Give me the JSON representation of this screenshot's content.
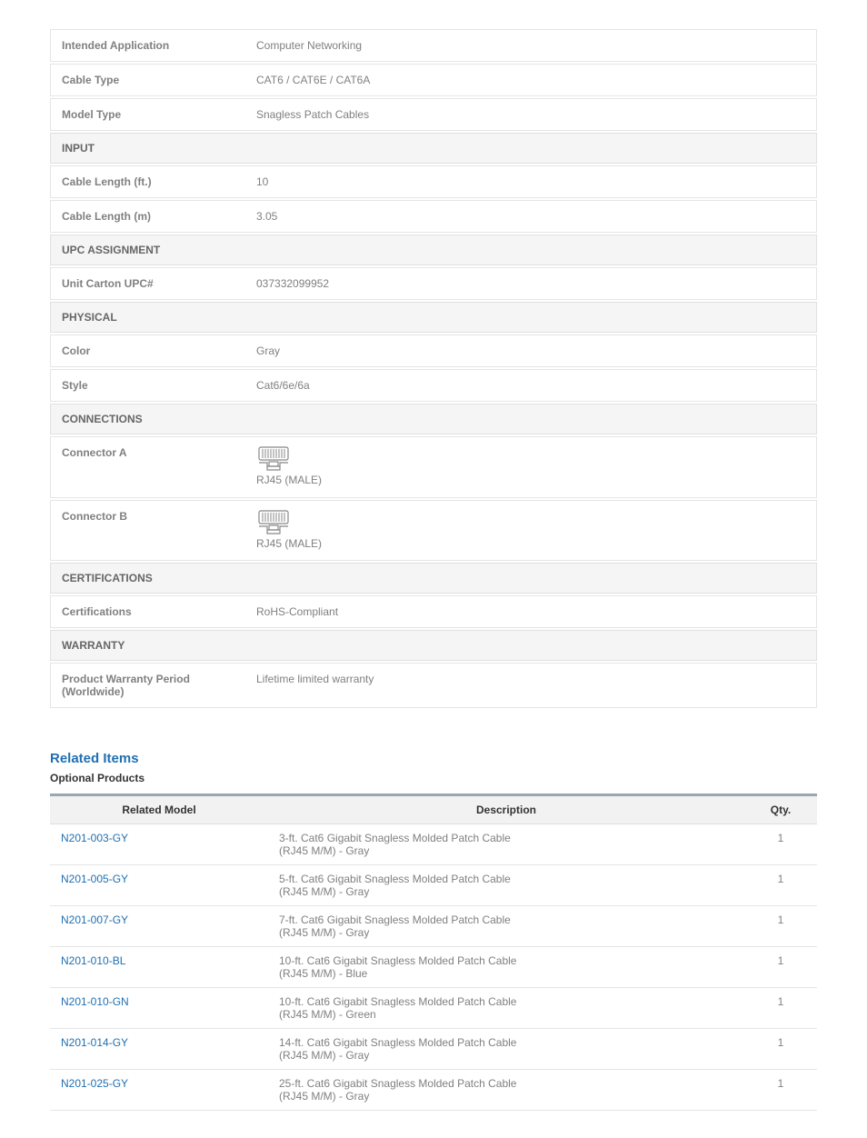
{
  "specs": {
    "rows": [
      {
        "type": "data",
        "label": "Intended Application",
        "value": "Computer Networking"
      },
      {
        "type": "data",
        "label": "Cable Type",
        "value": "CAT6 / CAT6E / CAT6A"
      },
      {
        "type": "data",
        "label": "Model Type",
        "value": "Snagless Patch Cables"
      },
      {
        "type": "section",
        "label": "INPUT"
      },
      {
        "type": "data",
        "label": "Cable Length (ft.)",
        "value": "10"
      },
      {
        "type": "data",
        "label": "Cable Length (m)",
        "value": "3.05"
      },
      {
        "type": "section",
        "label": "UPC ASSIGNMENT"
      },
      {
        "type": "data",
        "label": "Unit Carton UPC#",
        "value": "037332099952"
      },
      {
        "type": "section",
        "label": "PHYSICAL"
      },
      {
        "type": "data",
        "label": "Color",
        "value": "Gray"
      },
      {
        "type": "data",
        "label": "Style",
        "value": "Cat6/6e/6a"
      },
      {
        "type": "section",
        "label": "CONNECTIONS"
      },
      {
        "type": "connector",
        "label": "Connector A",
        "value": "RJ45 (MALE)"
      },
      {
        "type": "connector",
        "label": "Connector B",
        "value": "RJ45 (MALE)"
      },
      {
        "type": "section",
        "label": "CERTIFICATIONS"
      },
      {
        "type": "data",
        "label": "Certifications",
        "value": "RoHS-Compliant"
      },
      {
        "type": "section",
        "label": "WARRANTY"
      },
      {
        "type": "data",
        "label": "Product Warranty Period (Worldwide)",
        "value": "Lifetime limited warranty"
      }
    ]
  },
  "related": {
    "heading": "Related Items",
    "subheading": "Optional Products",
    "columns": {
      "model": "Related Model",
      "description": "Description",
      "qty": "Qty."
    },
    "items": [
      {
        "model": "N201-003-GY",
        "desc1": "3-ft. Cat6 Gigabit Snagless Molded Patch Cable",
        "desc2": "(RJ45 M/M) - Gray",
        "qty": "1"
      },
      {
        "model": "N201-005-GY",
        "desc1": "5-ft. Cat6 Gigabit Snagless Molded Patch Cable",
        "desc2": "(RJ45 M/M) - Gray",
        "qty": "1"
      },
      {
        "model": "N201-007-GY",
        "desc1": "7-ft. Cat6 Gigabit Snagless Molded Patch Cable",
        "desc2": "(RJ45 M/M) - Gray",
        "qty": "1"
      },
      {
        "model": "N201-010-BL",
        "desc1": "10-ft. Cat6 Gigabit Snagless Molded Patch Cable",
        "desc2": "(RJ45 M/M) - Blue",
        "qty": "1"
      },
      {
        "model": "N201-010-GN",
        "desc1": "10-ft. Cat6 Gigabit Snagless Molded Patch Cable",
        "desc2": "(RJ45 M/M) - Green",
        "qty": "1"
      },
      {
        "model": "N201-014-GY",
        "desc1": "14-ft. Cat6 Gigabit Snagless Molded Patch Cable",
        "desc2": "(RJ45 M/M) - Gray",
        "qty": "1"
      },
      {
        "model": "N201-025-GY",
        "desc1": "25-ft. Cat6 Gigabit Snagless Molded Patch Cable",
        "desc2": "(RJ45 M/M) - Gray",
        "qty": "1"
      }
    ]
  }
}
